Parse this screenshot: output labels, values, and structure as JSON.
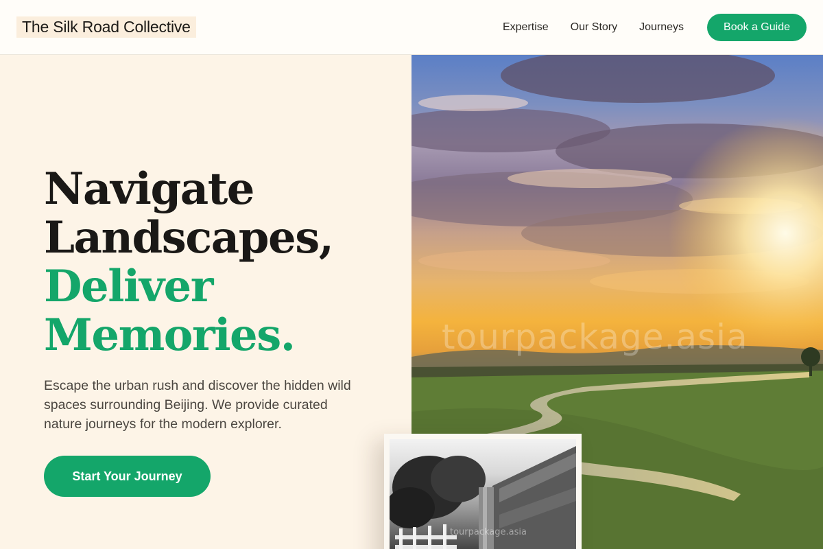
{
  "header": {
    "brand": "The Silk Road Collective",
    "nav": [
      {
        "label": "Expertise"
      },
      {
        "label": "Our Story"
      },
      {
        "label": "Journeys"
      }
    ],
    "cta_label": "Book a Guide"
  },
  "hero": {
    "headline": {
      "line1": "Navigate",
      "line2": "Landscapes,",
      "line3": "Deliver",
      "line4": "Memories."
    },
    "subtext": "Escape the urban rush and discover the hidden wild spaces surrounding Beijing. We provide curated nature journeys for the modern explorer.",
    "cta_label": "Start Your Journey",
    "image_watermark": "tourpackage.asia",
    "card_watermark": "tourpackage.asia"
  },
  "colors": {
    "accent": "#14a66a",
    "background": "#fdf4e7",
    "text": "#1a1816"
  },
  "icons": {
    "hero_image": "sunset-landscape-photo",
    "card_image": "black-and-white-fence-photo"
  }
}
